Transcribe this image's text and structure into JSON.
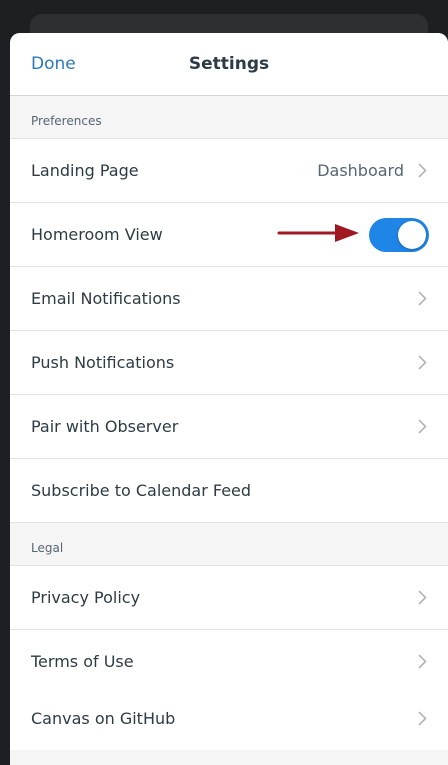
{
  "navbar": {
    "done_label": "Done",
    "title": "Settings"
  },
  "sections": {
    "preferences": {
      "header": "Preferences",
      "landing_page": {
        "label": "Landing Page",
        "value": "Dashboard"
      },
      "homeroom_view": {
        "label": "Homeroom View",
        "toggle_on": true
      },
      "email_notifications": {
        "label": "Email Notifications"
      },
      "push_notifications": {
        "label": "Push Notifications"
      },
      "pair_with_observer": {
        "label": "Pair with Observer"
      },
      "subscribe_calendar": {
        "label": "Subscribe to Calendar Feed"
      }
    },
    "legal": {
      "header": "Legal",
      "privacy_policy": {
        "label": "Privacy Policy"
      },
      "terms_of_use": {
        "label": "Terms of Use"
      },
      "canvas_github": {
        "label": "Canvas on GitHub"
      }
    }
  },
  "colors": {
    "accent": "#2b7abc",
    "toggle_on": "#1f85e6",
    "annotation_arrow": "#a01822",
    "text_primary": "#2d3b45",
    "text_secondary": "#556572"
  },
  "icons": {
    "chevron": "chevron-right-icon",
    "annotation": "arrow-right-icon"
  }
}
